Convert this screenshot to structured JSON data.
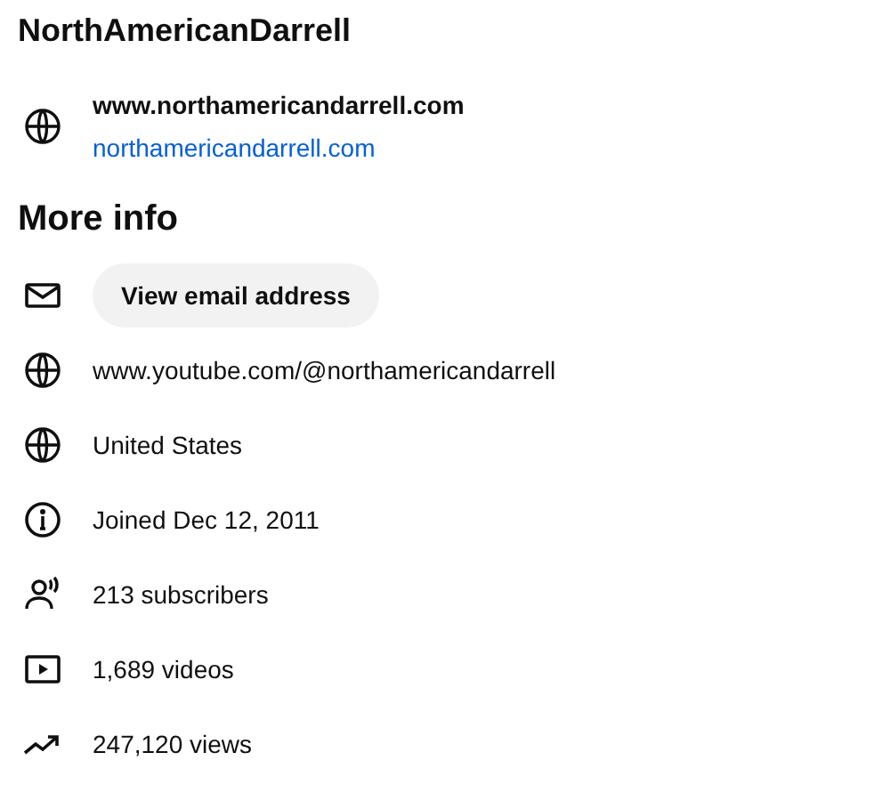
{
  "title": "NorthAmericanDarrell",
  "links": [
    {
      "title": "www.northamericandarrell.com",
      "url": "northamericandarrell.com"
    }
  ],
  "more_info": {
    "heading": "More info",
    "rows": [
      {
        "kind": "email",
        "text": "View email address"
      },
      {
        "kind": "channel",
        "text": "www.youtube.com/@northamericandarrell"
      },
      {
        "kind": "country",
        "text": "United States"
      },
      {
        "kind": "joined",
        "text": "Joined Dec 12, 2011"
      },
      {
        "kind": "subscribers",
        "text": "213 subscribers"
      },
      {
        "kind": "videos",
        "text": "1,689 videos"
      },
      {
        "kind": "views",
        "text": "247,120 views"
      }
    ]
  }
}
